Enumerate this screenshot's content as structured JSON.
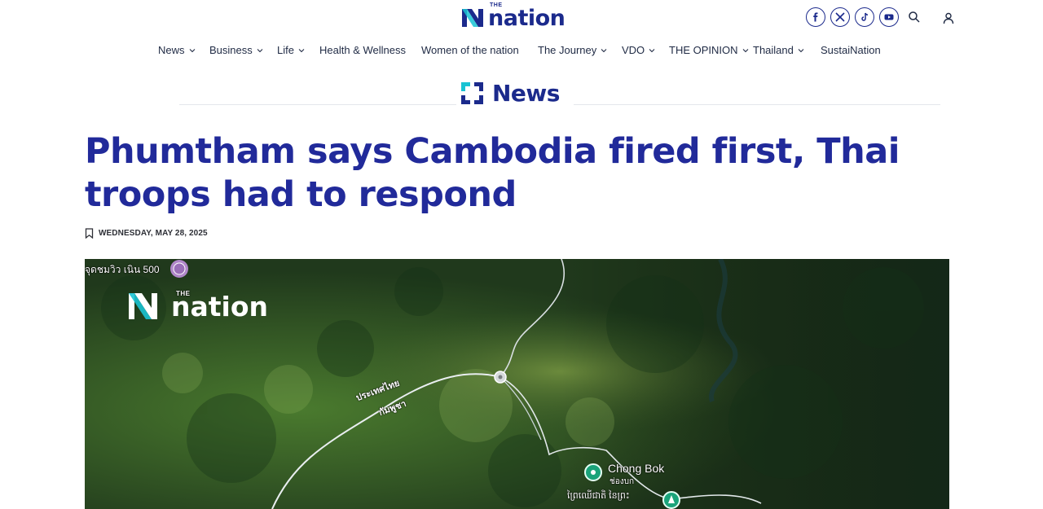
{
  "brand": {
    "the": "THE",
    "name": "nation"
  },
  "header": {
    "social_icons": [
      "facebook-icon",
      "x-twitter-icon",
      "tiktok-icon",
      "youtube-icon"
    ],
    "search_icon": "search-icon",
    "user_icon": "user-icon"
  },
  "nav": {
    "items": [
      {
        "label": "News",
        "dropdown": true
      },
      {
        "label": "Business",
        "dropdown": true
      },
      {
        "label": "Life",
        "dropdown": true
      },
      {
        "label": "Health & Wellness",
        "dropdown": false
      },
      {
        "label": "Women of the nation",
        "dropdown": false
      },
      {
        "label": "The Journey",
        "dropdown": true
      },
      {
        "label": "VDO",
        "dropdown": true
      },
      {
        "label": "THE OPINION",
        "dropdown": true
      },
      {
        "label": "Thailand",
        "dropdown": true
      },
      {
        "label": "SustaiNation",
        "dropdown": false
      }
    ]
  },
  "section": {
    "title": "News"
  },
  "article": {
    "headline": "Phumtham says Cambodia fired first, Thai troops had to respond",
    "date": "WEDNESDAY, MAY 28, 2025"
  },
  "hero_image": {
    "watermark_the": "THE",
    "watermark_name": "nation",
    "labels": {
      "top_left": "จุดชมวิว เนิน 500",
      "border_1": "ประเทศไทย",
      "border_2": "กัมพูชา",
      "place_en": "Chong Bok",
      "place_th": "ช่องบก",
      "place_km": "ព្រៃឈើជាតិ នៃព្រះ"
    }
  },
  "colors": {
    "brand_navy": "#1b2a8c",
    "brand_teal": "#19c3d3",
    "headline": "#212a9a"
  }
}
